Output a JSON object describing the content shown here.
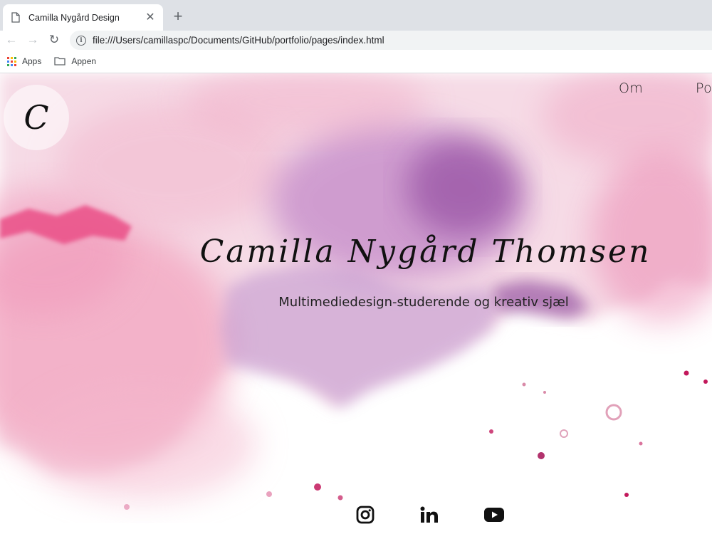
{
  "browser": {
    "tab_title": "Camilla Nygård Design",
    "tab_close": "✕",
    "new_tab": "+",
    "back": "←",
    "forward": "→",
    "reload": "↻",
    "info": "i",
    "url": "file:///Users/camillaspc/Documents/GitHub/portfolio/pages/index.html",
    "bookmarks": [
      {
        "label": "Apps",
        "icon": "apps-grid-icon"
      },
      {
        "label": "Appen",
        "icon": "folder-icon"
      }
    ]
  },
  "page": {
    "logo_letter": "C",
    "nav": {
      "om": "Om",
      "portfolio": "Por"
    },
    "hero_title": "Camilla Nygård Thomsen",
    "hero_subtitle": "Multimediedesign-studerende og kreativ sjæl",
    "social": [
      {
        "icon": "instagram-icon"
      },
      {
        "icon": "linkedin-icon"
      },
      {
        "icon": "youtube-icon"
      }
    ],
    "colors": {
      "pink": "#ea4f87",
      "purple": "#7b2f8f",
      "magenta": "#c2185b"
    }
  }
}
